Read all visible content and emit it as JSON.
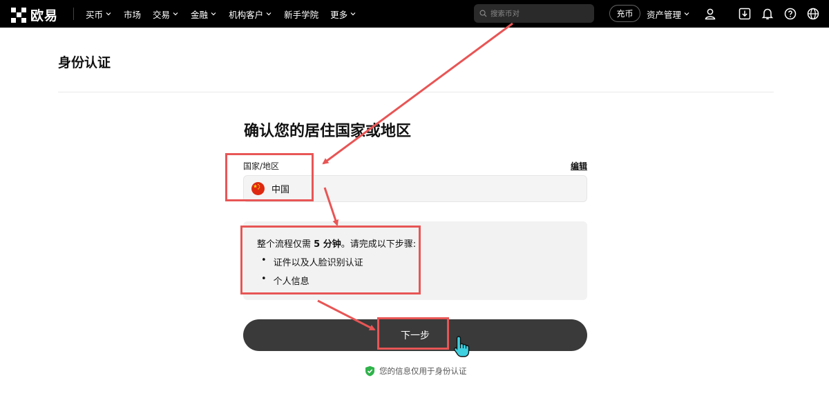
{
  "header": {
    "logo_text": "欧易",
    "nav": [
      {
        "label": "买币",
        "has_dropdown": true
      },
      {
        "label": "市场",
        "has_dropdown": false
      },
      {
        "label": "交易",
        "has_dropdown": true
      },
      {
        "label": "金融",
        "has_dropdown": true
      },
      {
        "label": "机构客户",
        "has_dropdown": true
      },
      {
        "label": "新手学院",
        "has_dropdown": false
      },
      {
        "label": "更多",
        "has_dropdown": true
      }
    ],
    "search_placeholder": "搜索币对",
    "deposit_label": "充币",
    "assets_label": "资产管理",
    "icons": [
      "user-icon",
      "download-icon",
      "bell-icon",
      "help-icon",
      "globe-icon"
    ]
  },
  "page": {
    "title": "身份认证",
    "main_title": "确认您的居住国家或地区",
    "country_label": "国家/地区",
    "edit_label": "编辑",
    "country_value": "中国",
    "info": {
      "prefix": "整个流程仅需 ",
      "highlight": "5 分钟",
      "suffix": "。请完成以下步骤:",
      "steps": [
        "证件以及人脸识别认证",
        "个人信息"
      ]
    },
    "next_label": "下一步",
    "privacy_text": "您的信息仅用于身份认证"
  },
  "colors": {
    "topbar": "#000000",
    "button": "#3a3a3a",
    "annotation": "#e85555",
    "shield": "#2fb34a",
    "flag_red": "#de2910",
    "flag_yellow": "#ffde00"
  }
}
